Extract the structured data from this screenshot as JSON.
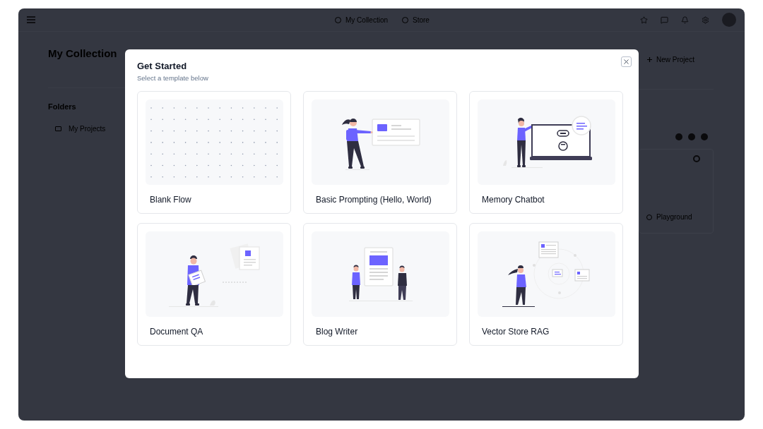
{
  "app_bar": {
    "nav": [
      {
        "label": "My Collection"
      },
      {
        "label": "Store"
      }
    ]
  },
  "page": {
    "title": "My Collection",
    "folders_heading": "Folders",
    "folders": [
      {
        "label": "My Projects"
      }
    ],
    "new_button": "New Project",
    "playground_button": "Playground"
  },
  "dialog": {
    "title": "Get Started",
    "subtitle": "Select a template below",
    "templates": [
      {
        "kind": "blank",
        "title": "Blank Flow"
      },
      {
        "kind": "prompting",
        "title": "Basic Prompting (Hello, World)"
      },
      {
        "kind": "chatbot",
        "title": "Memory Chatbot"
      },
      {
        "kind": "document",
        "title": "Document QA"
      },
      {
        "kind": "writer",
        "title": "Blog Writer"
      },
      {
        "kind": "rag",
        "title": "Vector Store RAG"
      }
    ]
  }
}
